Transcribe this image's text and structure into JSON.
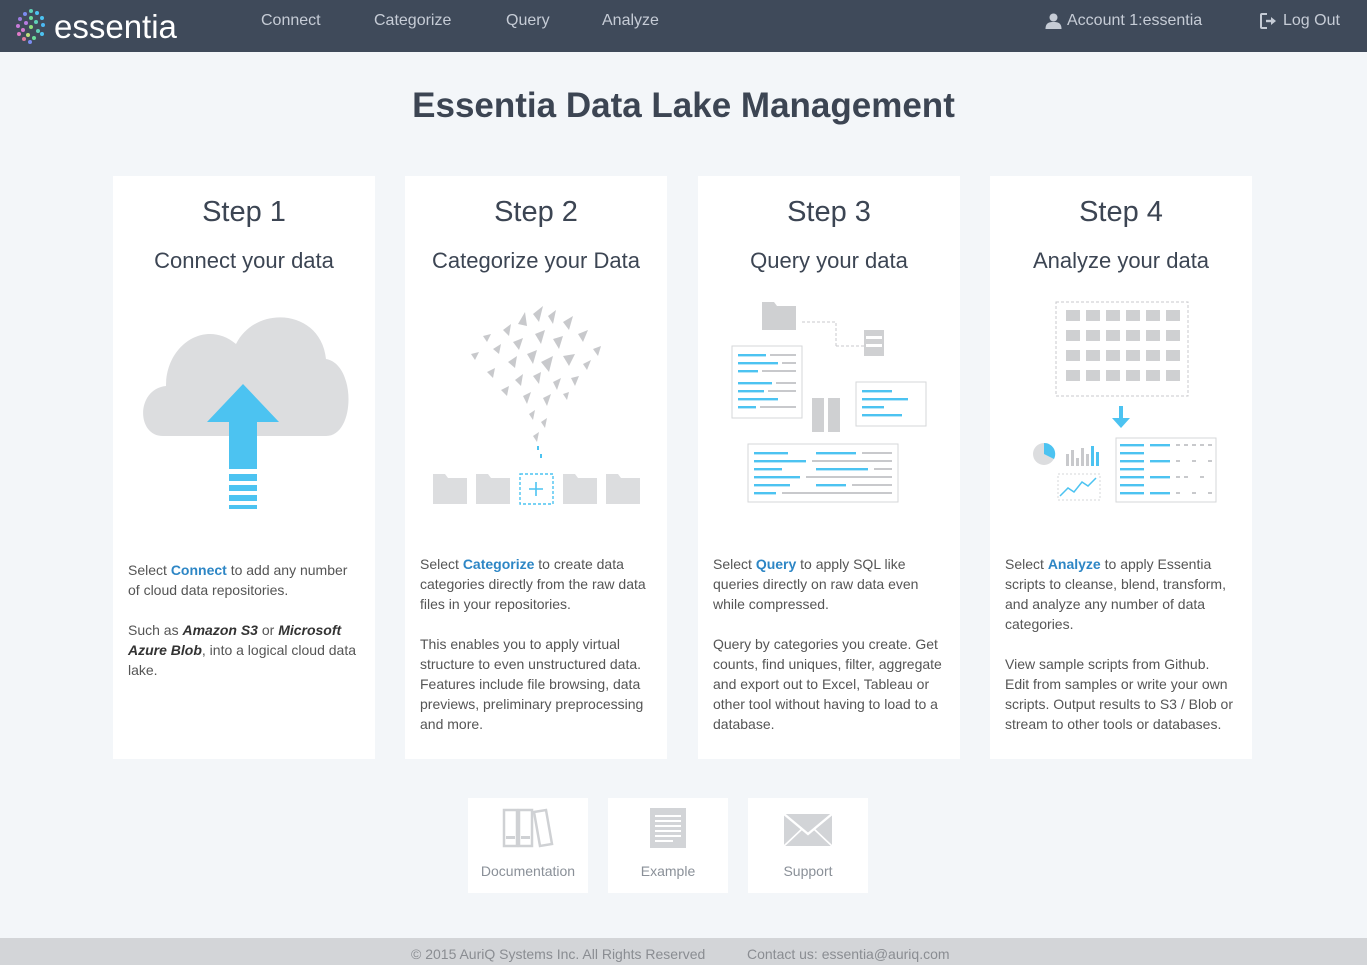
{
  "app": {
    "logo_text": "essentia"
  },
  "nav": {
    "items": [
      "Connect",
      "Categorize",
      "Query",
      "Analyze"
    ],
    "account": "Account 1:essentia",
    "logout": "Log Out"
  },
  "title": "Essentia Data Lake Management",
  "steps": [
    {
      "step": "Step 1",
      "subtitle": "Connect your data",
      "p1_pre": "Select ",
      "p1_hl": "Connect",
      "p1_post": " to add any number of cloud data repositories.",
      "p2_pre": "Such as ",
      "p2_em1": "Amazon S3",
      "p2_mid": " or ",
      "p2_em2": "Microsoft Azure Blob",
      "p2_post": ", into a logical cloud data lake."
    },
    {
      "step": "Step 2",
      "subtitle": "Categorize your Data",
      "p1_pre": "Select ",
      "p1_hl": "Categorize",
      "p1_post": " to create data categories directly from the raw data files in your repositories.",
      "p2": "This enables you to apply virtual structure to even unstructured data. Features include file browsing, data previews, preliminary preprocessing and more."
    },
    {
      "step": "Step 3",
      "subtitle": "Query your data",
      "p1_pre": "Select ",
      "p1_hl": "Query",
      "p1_post": " to apply SQL like queries directly on raw data even while compressed.",
      "p2": "Query by categories you create. Get counts, find uniques, filter, aggregate and export out to Excel, Tableau or other tool without having to load to a database."
    },
    {
      "step": "Step 4",
      "subtitle": "Analyze your data",
      "p1_pre": "Select ",
      "p1_hl": "Analyze",
      "p1_post": " to apply Essentia scripts to cleanse, blend, transform, and analyze any number of data categories.",
      "p2": "View sample scripts from Github. Edit from samples or write your own scripts. Output results to S3 / Blob or stream to other tools or databases."
    }
  ],
  "resources": [
    "Documentation",
    "Example",
    "Support"
  ],
  "footer": {
    "copyright": "© 2015 AuriQ Systems Inc. All Rights Reserved",
    "contact": "Contact us: essentia@auriq.com"
  },
  "colors": {
    "navbar": "#3f4a5a",
    "accent": "#2d86c5",
    "illustration_blue": "#4cc3f1",
    "illustration_gray": "#dcdddf"
  },
  "icons": [
    "essentia-logo-icon",
    "user-icon",
    "logout-icon",
    "cloud-upload-icon",
    "scatter-folders-icon",
    "query-docs-icon",
    "analyze-grid-icon",
    "books-icon",
    "document-icon",
    "envelope-icon"
  ]
}
